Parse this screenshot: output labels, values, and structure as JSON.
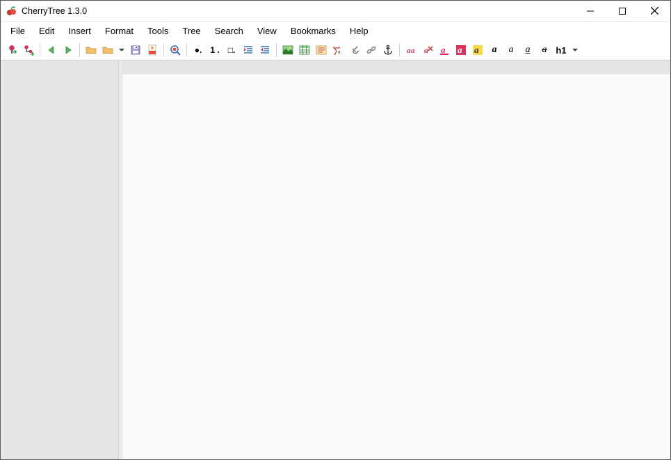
{
  "window": {
    "title": "CherryTree 1.3.0"
  },
  "menu": {
    "items": [
      "File",
      "Edit",
      "Insert",
      "Format",
      "Tools",
      "Tree",
      "Search",
      "View",
      "Bookmarks",
      "Help"
    ]
  },
  "toolbar": {
    "bullet_glyph": "●.",
    "number_glyph": "1 .",
    "checkbox_glyph": "□.",
    "h1_label": "h1"
  }
}
